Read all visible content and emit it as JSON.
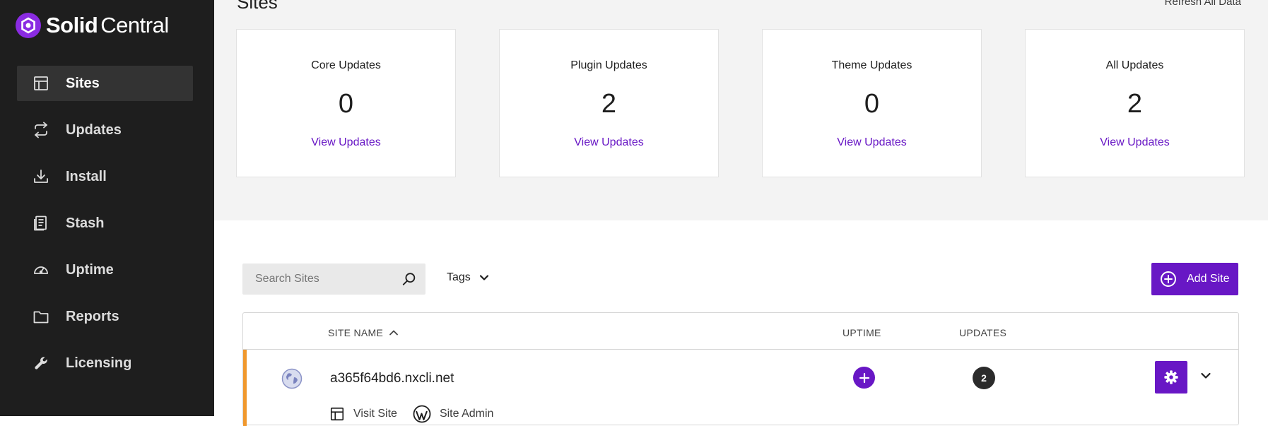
{
  "brand": {
    "solid": "Solid",
    "central": "Central"
  },
  "sidebar": {
    "items": [
      {
        "label": "Sites",
        "icon": "sites-icon",
        "active": true
      },
      {
        "label": "Updates",
        "icon": "updates-icon"
      },
      {
        "label": "Install",
        "icon": "install-icon"
      },
      {
        "label": "Stash",
        "icon": "stash-icon"
      },
      {
        "label": "Uptime",
        "icon": "uptime-icon"
      },
      {
        "label": "Reports",
        "icon": "reports-icon"
      },
      {
        "label": "Licensing",
        "icon": "licensing-icon"
      }
    ]
  },
  "header": {
    "title": "Sites",
    "refresh_label": "Refresh All Data"
  },
  "cards": [
    {
      "title": "Core Updates",
      "count": "0",
      "link": "View Updates"
    },
    {
      "title": "Plugin Updates",
      "count": "2",
      "link": "View Updates"
    },
    {
      "title": "Theme Updates",
      "count": "0",
      "link": "View Updates"
    },
    {
      "title": "All Updates",
      "count": "2",
      "link": "View Updates"
    }
  ],
  "search": {
    "placeholder": "Search Sites",
    "value": ""
  },
  "filters": {
    "tags_label": "Tags"
  },
  "actions": {
    "add_site_label": "Add Site"
  },
  "table": {
    "columns": {
      "site_name": "SITE NAME",
      "uptime": "UPTIME",
      "updates": "UPDATES"
    },
    "rows": [
      {
        "site_name": "a365f64bd6.nxcli.net",
        "updates_count": "2",
        "visit_label": "Visit Site",
        "admin_label": "Site Admin"
      }
    ]
  },
  "colors": {
    "accent": "#6817c5",
    "sidebar_bg": "#1e1e1e",
    "row_marker": "#f0982d"
  }
}
